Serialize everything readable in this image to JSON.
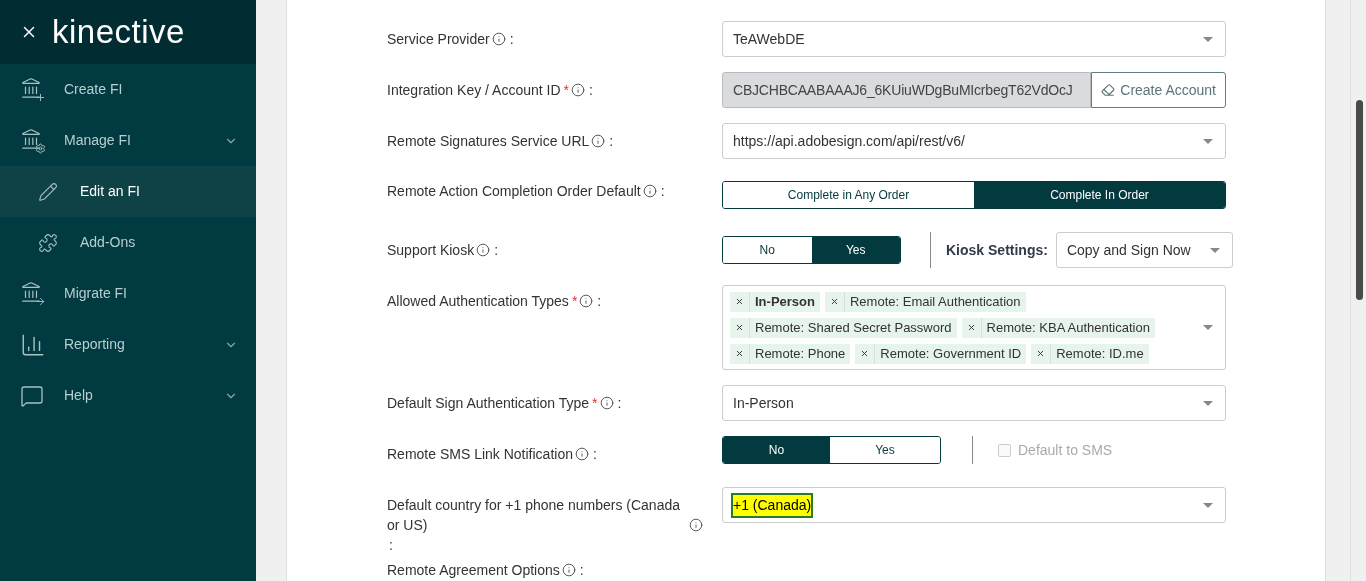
{
  "sidebar": {
    "logo": "kinective",
    "items": [
      {
        "label": "Create FI",
        "expandable": false,
        "selected": false
      },
      {
        "label": "Manage FI",
        "expandable": true,
        "selected": false,
        "children": [
          {
            "label": "Edit an FI",
            "selected": true
          },
          {
            "label": "Add-Ons",
            "selected": false
          }
        ]
      },
      {
        "label": "Migrate FI",
        "expandable": false,
        "selected": false
      },
      {
        "label": "Reporting",
        "expandable": true,
        "selected": false
      },
      {
        "label": "Help",
        "expandable": true,
        "selected": false
      }
    ]
  },
  "form": {
    "rows": [
      {
        "kind": "select",
        "label": "Service Provider",
        "colon": ":",
        "value": "TeAWebDE",
        "highlighted": false
      },
      {
        "kind": "key",
        "label": "Integration Key / Account ID",
        "required_mark": "*",
        "colon": ":",
        "value": "CBJCHBCAABAAAJ6_6KUiuWDgBuMIcrbegT62VdOcJ",
        "button": "Create Account"
      },
      {
        "kind": "select",
        "label": "Remote Signatures Service URL",
        "colon": ":",
        "value": "https://api.adobesign.com/api/rest/v6/",
        "highlighted": false
      },
      {
        "kind": "toggle",
        "label": "Remote Action Completion Order Default",
        "colon": ":",
        "options": [
          {
            "label": "Complete in Any Order",
            "selected": false
          },
          {
            "label": "Complete In Order",
            "selected": true
          }
        ]
      },
      {
        "kind": "toggle_select",
        "label": "Support Kiosk",
        "colon": ":",
        "options": [
          {
            "label": "No",
            "selected": false
          },
          {
            "label": "Yes",
            "selected": true
          }
        ],
        "side_label": "Kiosk Settings:",
        "side_value": "Copy and Sign Now"
      },
      {
        "kind": "tags",
        "label": "Allowed Authentication Types",
        "required_mark": "*",
        "colon": ":",
        "tags": [
          {
            "label": "In-Person",
            "selected": true
          },
          {
            "label": "Remote: Email Authentication",
            "selected": false
          },
          {
            "label": "Remote: Shared Secret Password",
            "selected": false
          },
          {
            "label": "Remote: KBA Authentication",
            "selected": false
          },
          {
            "label": "Remote: Phone",
            "selected": false
          },
          {
            "label": "Remote: Government ID",
            "selected": false
          },
          {
            "label": "Remote: ID.me",
            "selected": false
          }
        ]
      },
      {
        "kind": "select",
        "label": "Default Sign Authentication Type",
        "required_mark": "*",
        "colon": ":",
        "value": "In-Person",
        "highlighted": false
      },
      {
        "kind": "toggle_checkbox",
        "label": "Remote SMS Link Notification",
        "colon": ":",
        "options": [
          {
            "label": "No",
            "selected": true
          },
          {
            "label": "Yes",
            "selected": false
          }
        ],
        "checkbox": {
          "label": "Default to SMS",
          "checked": false,
          "disabled": true
        }
      },
      {
        "kind": "select",
        "label": "Default country for +1 phone numbers (Canada or US)",
        "colon": ":",
        "value": "+1 (Canada)",
        "highlighted": true
      },
      {
        "kind": "label_only",
        "label": "Remote Agreement Options",
        "colon": ":"
      }
    ]
  }
}
